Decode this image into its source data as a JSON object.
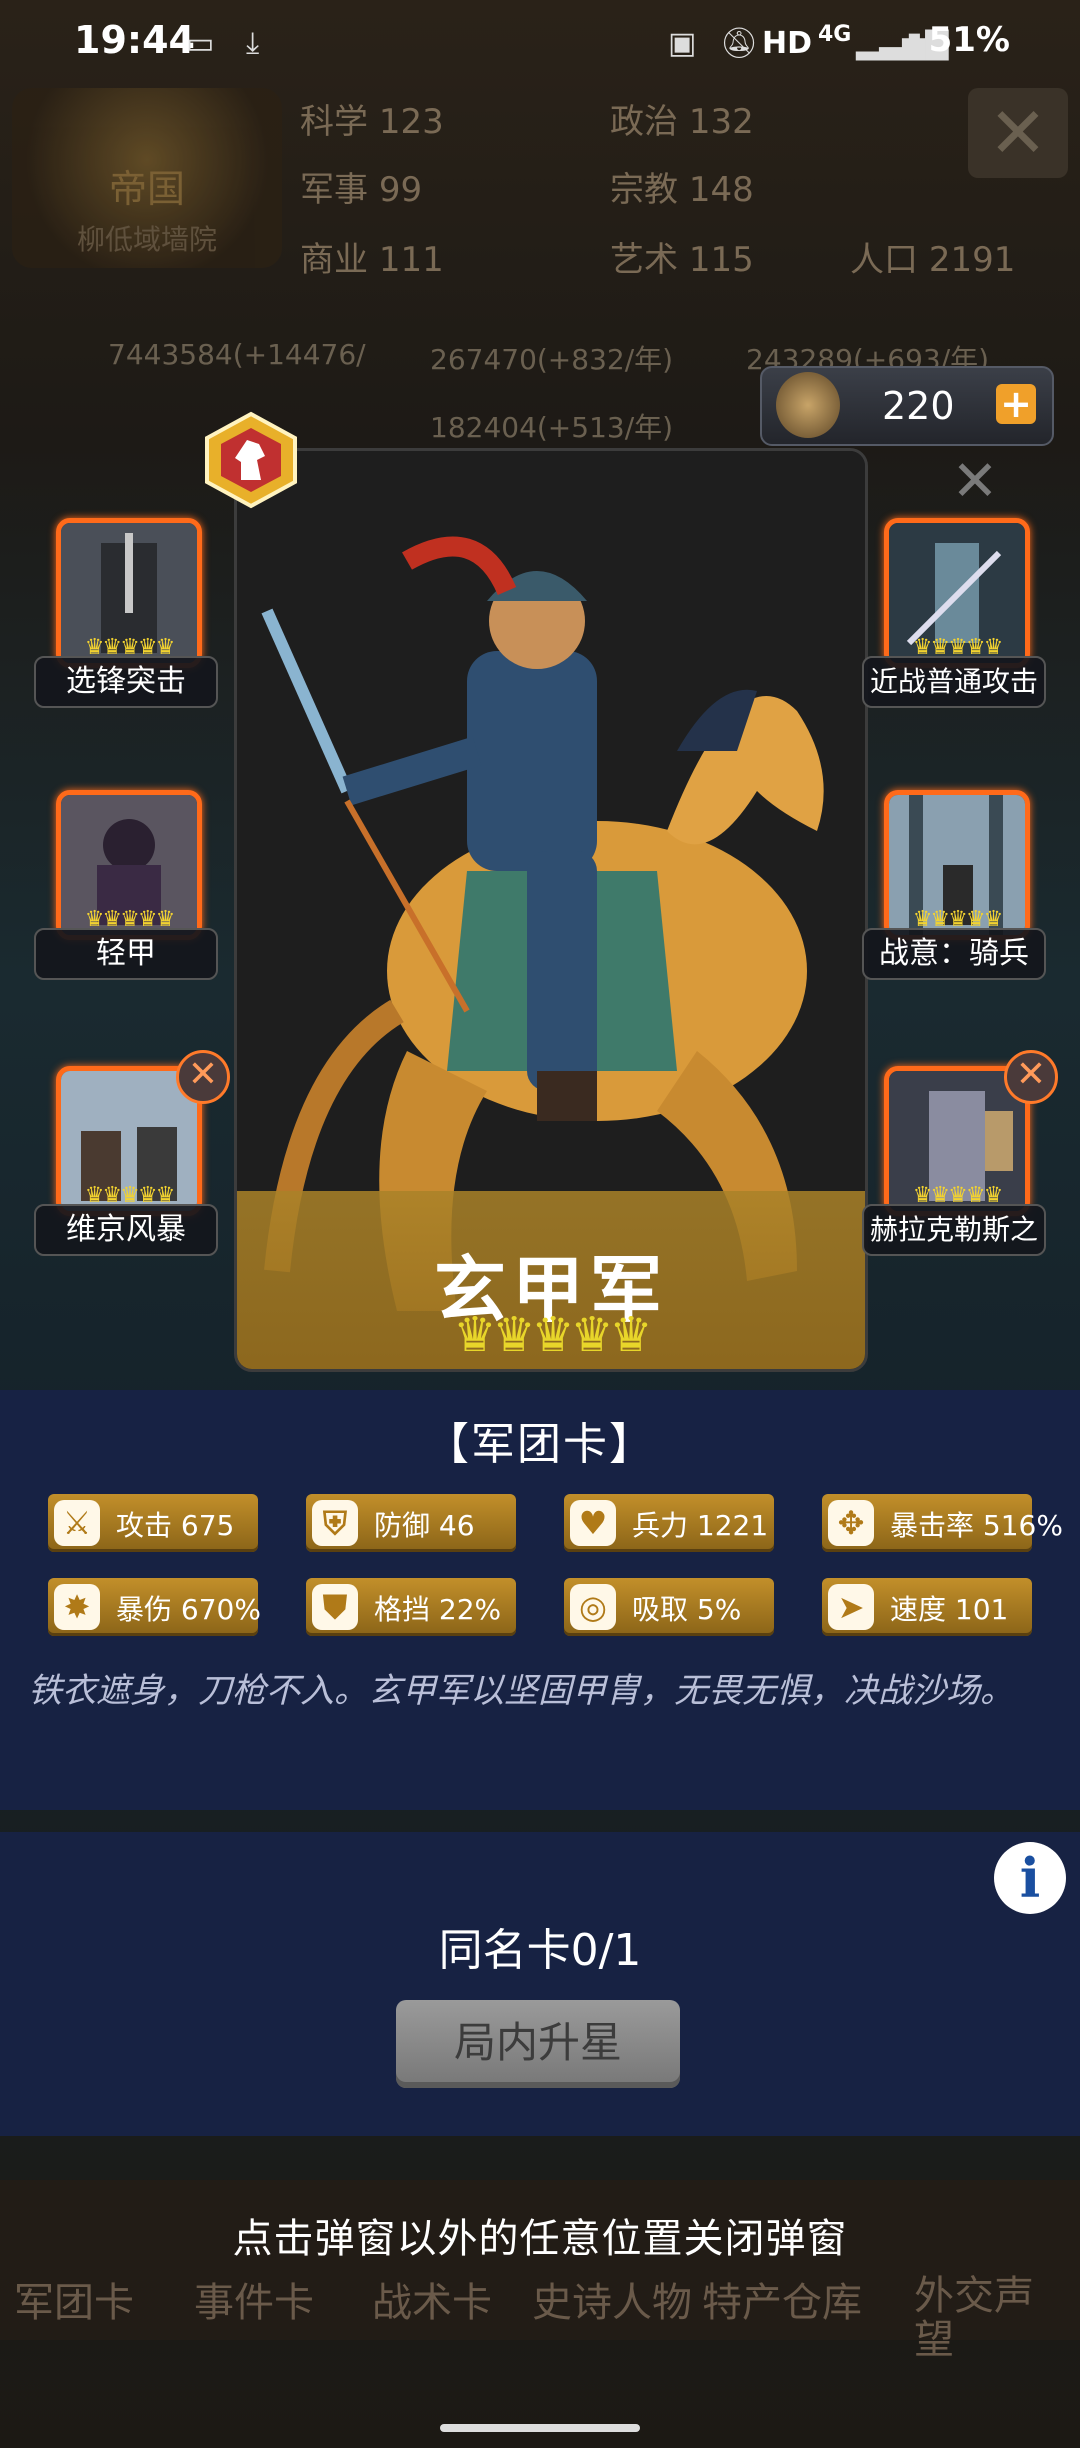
{
  "status_bar": {
    "time": "19:44",
    "network": "HD",
    "signal": "4G",
    "battery": "51%"
  },
  "background": {
    "empire_badge": {
      "title": "帝国",
      "subtitle": "柳低域墙院"
    },
    "stats": [
      {
        "label": "科学",
        "value": "123"
      },
      {
        "label": "政治",
        "value": "132"
      },
      {
        "label": "军事",
        "value": "99"
      },
      {
        "label": "宗教",
        "value": "148"
      },
      {
        "label": "商业",
        "value": "111"
      },
      {
        "label": "艺术",
        "value": "115"
      },
      {
        "label": "人口",
        "value": "2191"
      }
    ],
    "resources": [
      "7443584(+14476/",
      "267470(+832/年)",
      "243289(+693/年)",
      "182404(+513/年)"
    ],
    "tabs": [
      "军团卡",
      "事件卡",
      "战术卡",
      "史诗人物",
      "特产仓库",
      "外交声望"
    ]
  },
  "currency": {
    "amount": "220",
    "plus": "+"
  },
  "skills": {
    "left": [
      {
        "label": "选锋突击",
        "crowns": "♛♛♛♛♛"
      },
      {
        "label": "轻甲",
        "crowns": "♛♛♛♛♛"
      },
      {
        "label": "维京风暴",
        "crowns": "♛♛♛♛♛",
        "removable": true
      }
    ],
    "right": [
      {
        "label": "近战普通攻击",
        "crowns": "♛♛♛♛♛"
      },
      {
        "label": "战意：骑兵",
        "crowns": "♛♛♛♛♛"
      },
      {
        "label": "赫拉克勒斯之",
        "crowns": "♛♛♛♛♛",
        "removable": true
      }
    ]
  },
  "card": {
    "name": "玄甲军",
    "stars": "♛♛♛♛♛",
    "star_count": 5,
    "close": "✕"
  },
  "info": {
    "title": "【军团卡】",
    "attributes": [
      {
        "icon": "sword-icon",
        "label": "攻击",
        "value": "675"
      },
      {
        "icon": "shield-icon",
        "label": "防御",
        "value": "46"
      },
      {
        "icon": "heart-icon",
        "label": "兵力",
        "value": "1221"
      },
      {
        "icon": "crit-rate-icon",
        "label": "暴击率",
        "value": "516%"
      },
      {
        "icon": "crit-damage-icon",
        "label": "暴伤",
        "value": "670%"
      },
      {
        "icon": "block-icon",
        "label": "格挡",
        "value": "22%"
      },
      {
        "icon": "lifesteal-icon",
        "label": "吸取",
        "value": "5%"
      },
      {
        "icon": "speed-icon",
        "label": "速度",
        "value": "101"
      }
    ],
    "description": "铁衣遮身，刀枪不入。玄甲军以坚固甲胄，无畏无惧，决战沙场。"
  },
  "upgrade": {
    "info_icon": "i",
    "duplicate_count": "同名卡0/1",
    "button_label": "局内升星"
  },
  "hint": "点击弹窗以外的任意位置关闭弹窗",
  "colors": {
    "accent_gold": "#c28f2a",
    "frame_orange": "#ff6a1a",
    "panel_navy": "#182246",
    "crown_yellow": "#e8d62a"
  }
}
